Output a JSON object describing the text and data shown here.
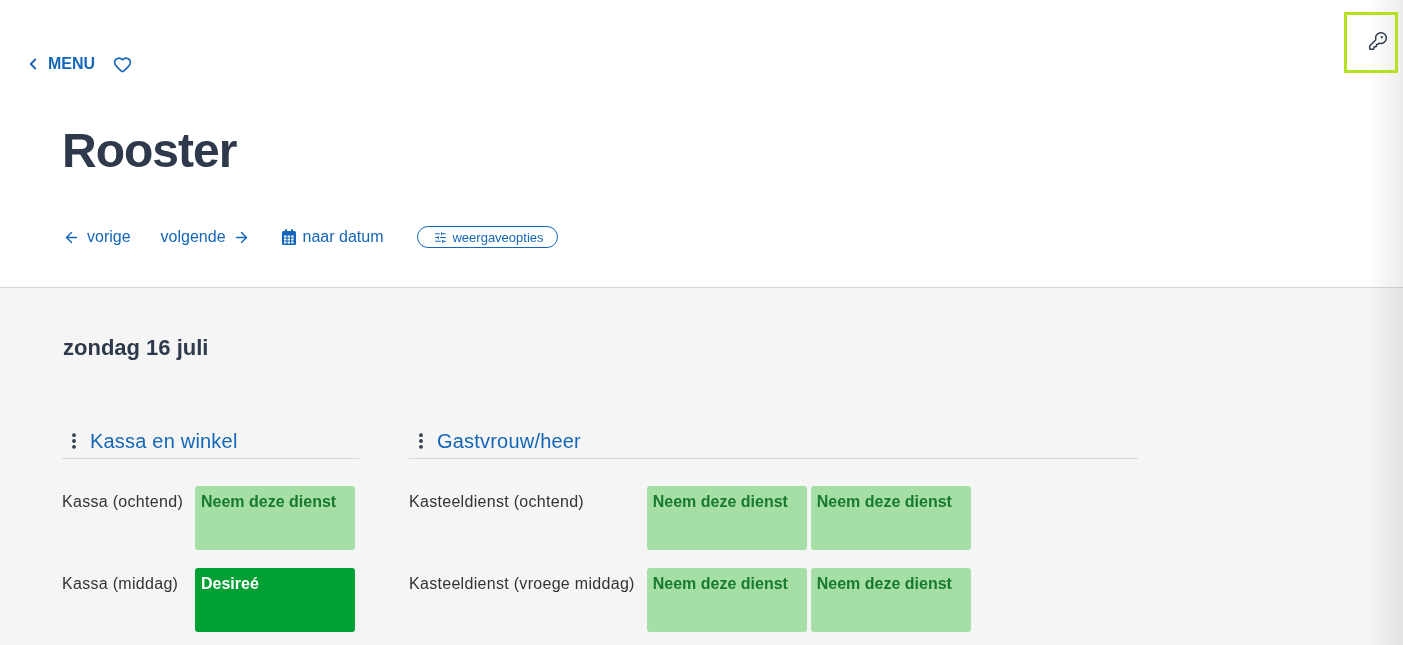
{
  "header": {
    "menu_link": "MENU",
    "title": "Rooster",
    "nav": [
      {
        "kind": "prev",
        "label": "vorige"
      },
      {
        "kind": "next",
        "label": "volgende"
      },
      {
        "kind": "date",
        "label": "naar datum"
      }
    ],
    "options_button": "weergaveopties"
  },
  "key_button": {
    "focused": true
  },
  "day": {
    "title": "zondag 16 juli",
    "groups": [
      {
        "title": "Kassa en winkel",
        "rows": [
          {
            "label": "Kassa (ochtend)",
            "shifts": [
              {
                "kind": "open",
                "text": "Neem deze dienst"
              }
            ]
          },
          {
            "label": "Kassa (middag)",
            "shifts": [
              {
                "kind": "assigned",
                "text": "Desireé"
              }
            ]
          }
        ]
      },
      {
        "title": "Gastvrouw/heer",
        "rows": [
          {
            "label": "Kasteeldienst (ochtend)",
            "shifts": [
              {
                "kind": "open",
                "text": "Neem deze dienst"
              },
              {
                "kind": "open",
                "text": "Neem deze dienst"
              }
            ]
          },
          {
            "label": "Kasteeldienst (vroege middag)",
            "shifts": [
              {
                "kind": "open",
                "text": "Neem deze dienst"
              },
              {
                "kind": "open",
                "text": "Neem deze dienst"
              }
            ]
          }
        ]
      }
    ]
  }
}
